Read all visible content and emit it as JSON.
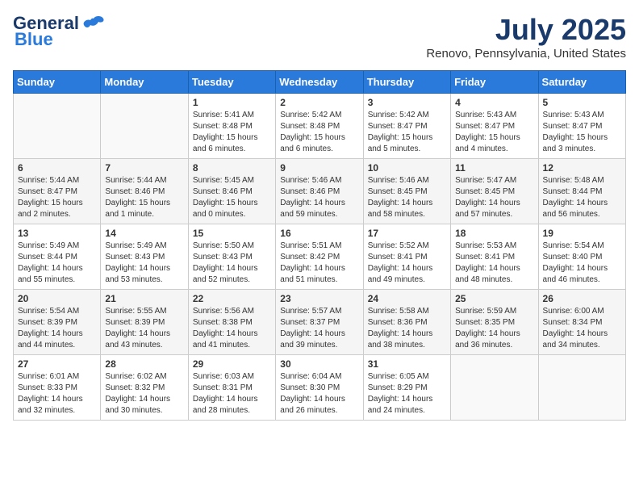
{
  "header": {
    "logo_general": "General",
    "logo_blue": "Blue",
    "month": "July 2025",
    "location": "Renovo, Pennsylvania, United States"
  },
  "weekdays": [
    "Sunday",
    "Monday",
    "Tuesday",
    "Wednesday",
    "Thursday",
    "Friday",
    "Saturday"
  ],
  "weeks": [
    [
      {
        "day": "",
        "info": ""
      },
      {
        "day": "",
        "info": ""
      },
      {
        "day": "1",
        "info": "Sunrise: 5:41 AM\nSunset: 8:48 PM\nDaylight: 15 hours and 6 minutes."
      },
      {
        "day": "2",
        "info": "Sunrise: 5:42 AM\nSunset: 8:48 PM\nDaylight: 15 hours and 6 minutes."
      },
      {
        "day": "3",
        "info": "Sunrise: 5:42 AM\nSunset: 8:47 PM\nDaylight: 15 hours and 5 minutes."
      },
      {
        "day": "4",
        "info": "Sunrise: 5:43 AM\nSunset: 8:47 PM\nDaylight: 15 hours and 4 minutes."
      },
      {
        "day": "5",
        "info": "Sunrise: 5:43 AM\nSunset: 8:47 PM\nDaylight: 15 hours and 3 minutes."
      }
    ],
    [
      {
        "day": "6",
        "info": "Sunrise: 5:44 AM\nSunset: 8:47 PM\nDaylight: 15 hours and 2 minutes."
      },
      {
        "day": "7",
        "info": "Sunrise: 5:44 AM\nSunset: 8:46 PM\nDaylight: 15 hours and 1 minute."
      },
      {
        "day": "8",
        "info": "Sunrise: 5:45 AM\nSunset: 8:46 PM\nDaylight: 15 hours and 0 minutes."
      },
      {
        "day": "9",
        "info": "Sunrise: 5:46 AM\nSunset: 8:46 PM\nDaylight: 14 hours and 59 minutes."
      },
      {
        "day": "10",
        "info": "Sunrise: 5:46 AM\nSunset: 8:45 PM\nDaylight: 14 hours and 58 minutes."
      },
      {
        "day": "11",
        "info": "Sunrise: 5:47 AM\nSunset: 8:45 PM\nDaylight: 14 hours and 57 minutes."
      },
      {
        "day": "12",
        "info": "Sunrise: 5:48 AM\nSunset: 8:44 PM\nDaylight: 14 hours and 56 minutes."
      }
    ],
    [
      {
        "day": "13",
        "info": "Sunrise: 5:49 AM\nSunset: 8:44 PM\nDaylight: 14 hours and 55 minutes."
      },
      {
        "day": "14",
        "info": "Sunrise: 5:49 AM\nSunset: 8:43 PM\nDaylight: 14 hours and 53 minutes."
      },
      {
        "day": "15",
        "info": "Sunrise: 5:50 AM\nSunset: 8:43 PM\nDaylight: 14 hours and 52 minutes."
      },
      {
        "day": "16",
        "info": "Sunrise: 5:51 AM\nSunset: 8:42 PM\nDaylight: 14 hours and 51 minutes."
      },
      {
        "day": "17",
        "info": "Sunrise: 5:52 AM\nSunset: 8:41 PM\nDaylight: 14 hours and 49 minutes."
      },
      {
        "day": "18",
        "info": "Sunrise: 5:53 AM\nSunset: 8:41 PM\nDaylight: 14 hours and 48 minutes."
      },
      {
        "day": "19",
        "info": "Sunrise: 5:54 AM\nSunset: 8:40 PM\nDaylight: 14 hours and 46 minutes."
      }
    ],
    [
      {
        "day": "20",
        "info": "Sunrise: 5:54 AM\nSunset: 8:39 PM\nDaylight: 14 hours and 44 minutes."
      },
      {
        "day": "21",
        "info": "Sunrise: 5:55 AM\nSunset: 8:39 PM\nDaylight: 14 hours and 43 minutes."
      },
      {
        "day": "22",
        "info": "Sunrise: 5:56 AM\nSunset: 8:38 PM\nDaylight: 14 hours and 41 minutes."
      },
      {
        "day": "23",
        "info": "Sunrise: 5:57 AM\nSunset: 8:37 PM\nDaylight: 14 hours and 39 minutes."
      },
      {
        "day": "24",
        "info": "Sunrise: 5:58 AM\nSunset: 8:36 PM\nDaylight: 14 hours and 38 minutes."
      },
      {
        "day": "25",
        "info": "Sunrise: 5:59 AM\nSunset: 8:35 PM\nDaylight: 14 hours and 36 minutes."
      },
      {
        "day": "26",
        "info": "Sunrise: 6:00 AM\nSunset: 8:34 PM\nDaylight: 14 hours and 34 minutes."
      }
    ],
    [
      {
        "day": "27",
        "info": "Sunrise: 6:01 AM\nSunset: 8:33 PM\nDaylight: 14 hours and 32 minutes."
      },
      {
        "day": "28",
        "info": "Sunrise: 6:02 AM\nSunset: 8:32 PM\nDaylight: 14 hours and 30 minutes."
      },
      {
        "day": "29",
        "info": "Sunrise: 6:03 AM\nSunset: 8:31 PM\nDaylight: 14 hours and 28 minutes."
      },
      {
        "day": "30",
        "info": "Sunrise: 6:04 AM\nSunset: 8:30 PM\nDaylight: 14 hours and 26 minutes."
      },
      {
        "day": "31",
        "info": "Sunrise: 6:05 AM\nSunset: 8:29 PM\nDaylight: 14 hours and 24 minutes."
      },
      {
        "day": "",
        "info": ""
      },
      {
        "day": "",
        "info": ""
      }
    ]
  ]
}
